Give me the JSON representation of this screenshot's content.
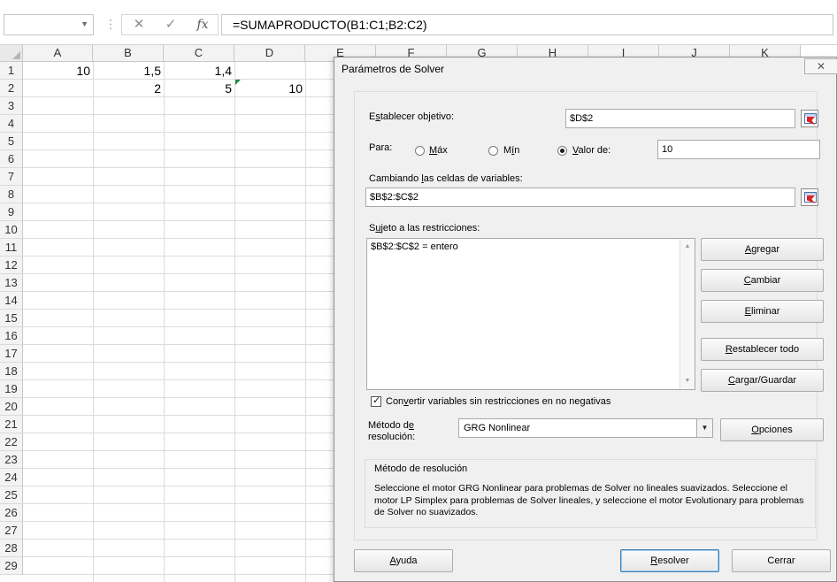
{
  "formula_bar": {
    "name_box": "",
    "cancel_glyph": "✕",
    "enter_glyph": "✓",
    "fx_label": "fx",
    "formula": "=SUMAPRODUCTO(B1:C1;B2:C2)"
  },
  "sheet": {
    "columns": [
      "A",
      "B",
      "C",
      "D",
      "E",
      "F",
      "G",
      "H",
      "I",
      "J",
      "K"
    ],
    "rows": [
      "1",
      "2",
      "3",
      "4",
      "5",
      "6",
      "7",
      "8",
      "9",
      "10",
      "11",
      "12",
      "13",
      "14",
      "15",
      "16",
      "17",
      "18",
      "19",
      "20",
      "21",
      "22",
      "23",
      "24",
      "25",
      "26",
      "27",
      "28",
      "29"
    ],
    "cells": {
      "A1": "10",
      "B1": "1,5",
      "C1": "1,4",
      "B2": "2",
      "C2": "5",
      "D2": "10"
    }
  },
  "dialog": {
    "title": "Parámetros de Solver",
    "close_glyph": "✕",
    "objective": {
      "label_pre": "E",
      "label_u": "s",
      "label_post": "tablecer objetivo:",
      "value": "$D$2"
    },
    "to": {
      "label": "Para:",
      "max_pre": "",
      "max_u": "M",
      "max_post": "áx",
      "min_pre": "M",
      "min_u": "í",
      "min_post": "n",
      "value_pre": "",
      "value_u": "V",
      "value_post": "alor de:",
      "value": "10",
      "selected": "value"
    },
    "variables": {
      "label_pre": "Cambiando ",
      "label_u": "l",
      "label_post": "as celdas de variables:",
      "value": "$B$2:$C$2"
    },
    "constraints": {
      "label_pre": "S",
      "label_u": "u",
      "label_post": "jeto a las restricciones:",
      "items": [
        "$B$2:$C$2 = entero"
      ],
      "scroll_up": "▲",
      "scroll_down": "▼"
    },
    "buttons": {
      "add_pre": "",
      "add_u": "A",
      "add_post": "gregar",
      "change_pre": "",
      "change_u": "C",
      "change_post": "ambiar",
      "delete_pre": "",
      "delete_u": "E",
      "delete_post": "liminar",
      "reset_pre": "",
      "reset_u": "R",
      "reset_post": "establecer todo",
      "load_pre": "",
      "load_u": "C",
      "load_post": "argar/Guardar",
      "options_pre": "",
      "options_u": "O",
      "options_post": "pciones",
      "help_pre": "",
      "help_u": "A",
      "help_post": "yuda",
      "solve_pre": "",
      "solve_u": "R",
      "solve_post": "esolver",
      "close": "Cerrar"
    },
    "nonneg": {
      "label_pre": "Con",
      "label_u": "v",
      "label_post": "ertir variables sin restricciones en no negativas",
      "checked": true
    },
    "method": {
      "label_line1_pre": "Método d",
      "label_line1_u": "e",
      "label_line2": "resolución:",
      "selected": "GRG Nonlinear",
      "dropdown_glyph": "▼"
    },
    "method_group": {
      "title": "Método de resolución",
      "text": "Seleccione el motor GRG Nonlinear para problemas de Solver no lineales suavizados. Seleccione el motor LP Simplex para problemas de Solver lineales, y seleccione el motor Evolutionary para problemas de Solver no suavizados."
    }
  }
}
